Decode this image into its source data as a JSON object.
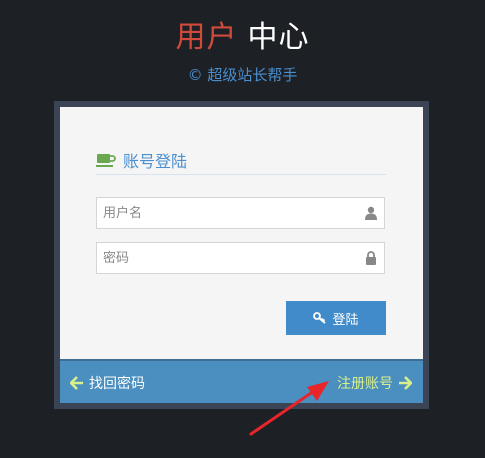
{
  "header": {
    "title_part1": "用户",
    "title_part2": "中心",
    "subtitle": "© 超级站长帮手"
  },
  "login_form": {
    "heading": "账号登陆",
    "username_placeholder": "用户名",
    "password_placeholder": "密码",
    "submit_label": "登陆"
  },
  "toolbar": {
    "forgot_label": "找回密码",
    "register_label": "注册账号"
  },
  "icons": {
    "heading": "coffee-icon",
    "username": "user-icon",
    "password": "lock-icon",
    "submit": "key-icon",
    "forgot": "arrow-left-icon",
    "register": "arrow-right-icon",
    "annotation": "red-pointer-arrow"
  },
  "colors": {
    "background": "#1d2024",
    "title_accent": "#d24a3c",
    "link_blue": "#4a8fd0",
    "button_blue": "#428bca",
    "toolbar_blue": "#4a8fc0",
    "register_link": "#d8f08a",
    "annotation_red": "#e8262a"
  }
}
